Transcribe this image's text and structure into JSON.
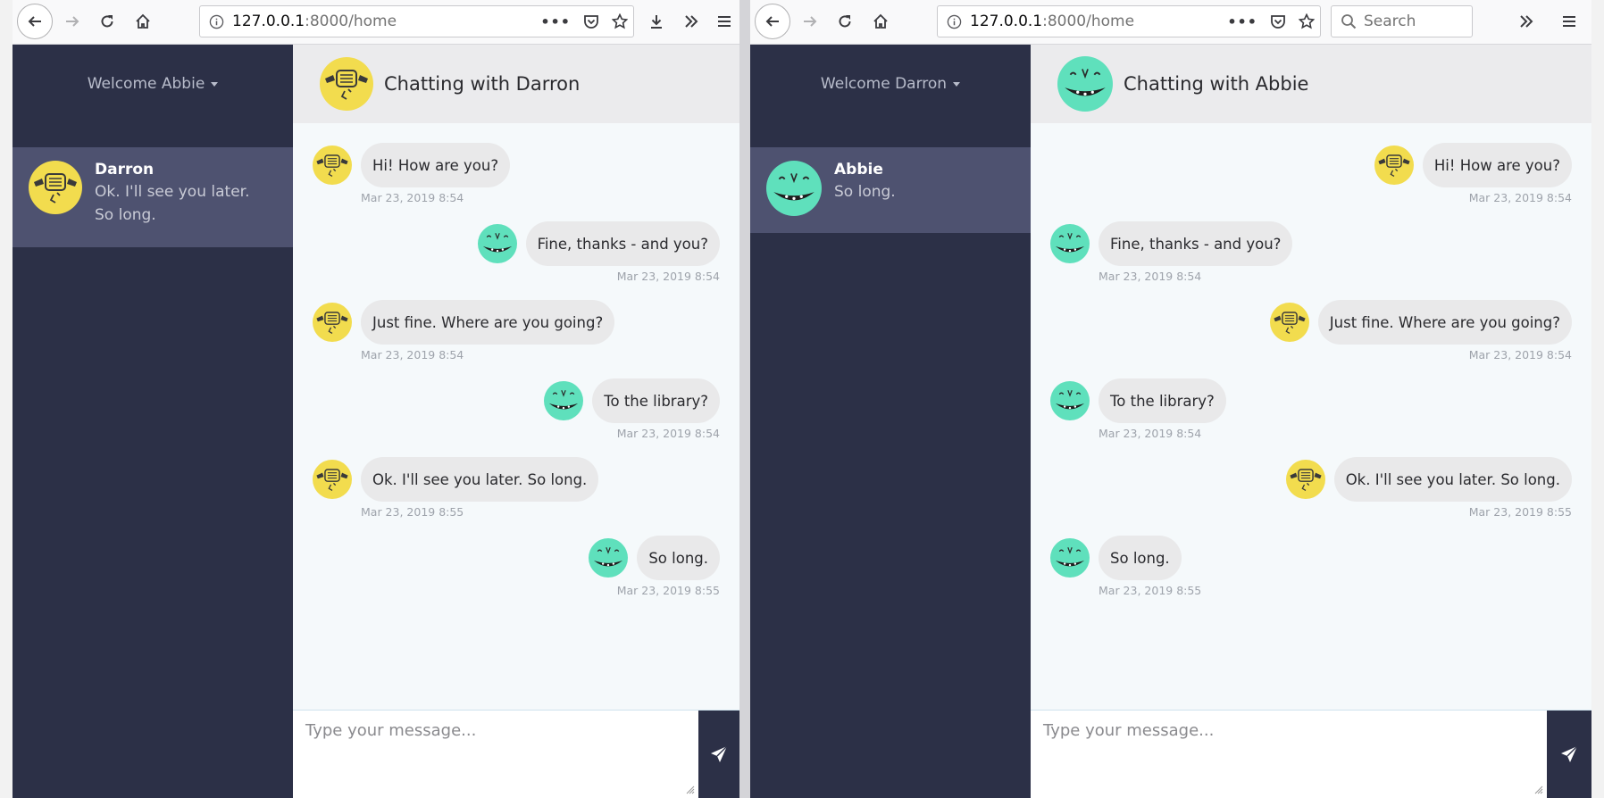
{
  "left": {
    "url": {
      "host": "127.0.0.1",
      "rest": ":8000/home"
    },
    "welcome": "Welcome Abbie",
    "contact": {
      "name": "Darron",
      "preview": "Ok. I'll see you later. So long."
    },
    "chat_title": "Chatting with Darron",
    "messages": [
      {
        "text": "Hi! How are you?",
        "time": "Mar 23, 2019 8:54",
        "side": "left",
        "avatar": "yellow"
      },
      {
        "text": "Fine, thanks - and you?",
        "time": "Mar 23, 2019 8:54",
        "side": "right",
        "avatar": "green"
      },
      {
        "text": "Just fine. Where are you going?",
        "time": "Mar 23, 2019 8:54",
        "side": "left",
        "avatar": "yellow"
      },
      {
        "text": "To the library?",
        "time": "Mar 23, 2019 8:54",
        "side": "right",
        "avatar": "green"
      },
      {
        "text": "Ok. I'll see you later. So long.",
        "time": "Mar 23, 2019 8:55",
        "side": "left",
        "avatar": "yellow"
      },
      {
        "text": "So long.",
        "time": "Mar 23, 2019 8:55",
        "side": "right",
        "avatar": "green"
      }
    ],
    "placeholder": "Type your message..."
  },
  "right": {
    "url": {
      "host": "127.0.0.1",
      "rest": ":8000/home"
    },
    "search_placeholder": "Search",
    "welcome": "Welcome Darron",
    "contact": {
      "name": "Abbie",
      "preview": "So long."
    },
    "chat_title": "Chatting with Abbie",
    "messages": [
      {
        "text": "Hi! How are you?",
        "time": "Mar 23, 2019 8:54",
        "side": "right",
        "avatar": "yellow"
      },
      {
        "text": "Fine, thanks - and you?",
        "time": "Mar 23, 2019 8:54",
        "side": "left",
        "avatar": "green"
      },
      {
        "text": "Just fine. Where are you going?",
        "time": "Mar 23, 2019 8:54",
        "side": "right",
        "avatar": "yellow"
      },
      {
        "text": "To the library?",
        "time": "Mar 23, 2019 8:54",
        "side": "left",
        "avatar": "green"
      },
      {
        "text": "Ok. I'll see you later. So long.",
        "time": "Mar 23, 2019 8:55",
        "side": "right",
        "avatar": "yellow"
      },
      {
        "text": "So long.",
        "time": "Mar 23, 2019 8:55",
        "side": "left",
        "avatar": "green"
      }
    ],
    "placeholder": "Type your message..."
  },
  "icons": {
    "back": "arrow-left-icon",
    "forward": "arrow-right-icon",
    "reload": "reload-icon",
    "home": "home-icon",
    "info": "info-icon",
    "more": "more-dots-icon",
    "pocket": "pocket-icon",
    "bookmark": "star-icon",
    "download": "download-icon",
    "overflow": "chevrons-right-icon",
    "menu": "hamburger-icon",
    "search": "search-icon",
    "send": "send-icon"
  },
  "colors": {
    "sidebar": "#2c3047",
    "sidebar_active": "#4e5270",
    "avatar_yellow": "#f2dc4e",
    "avatar_green": "#5fe0bc",
    "bubble": "#e9e9ea"
  }
}
